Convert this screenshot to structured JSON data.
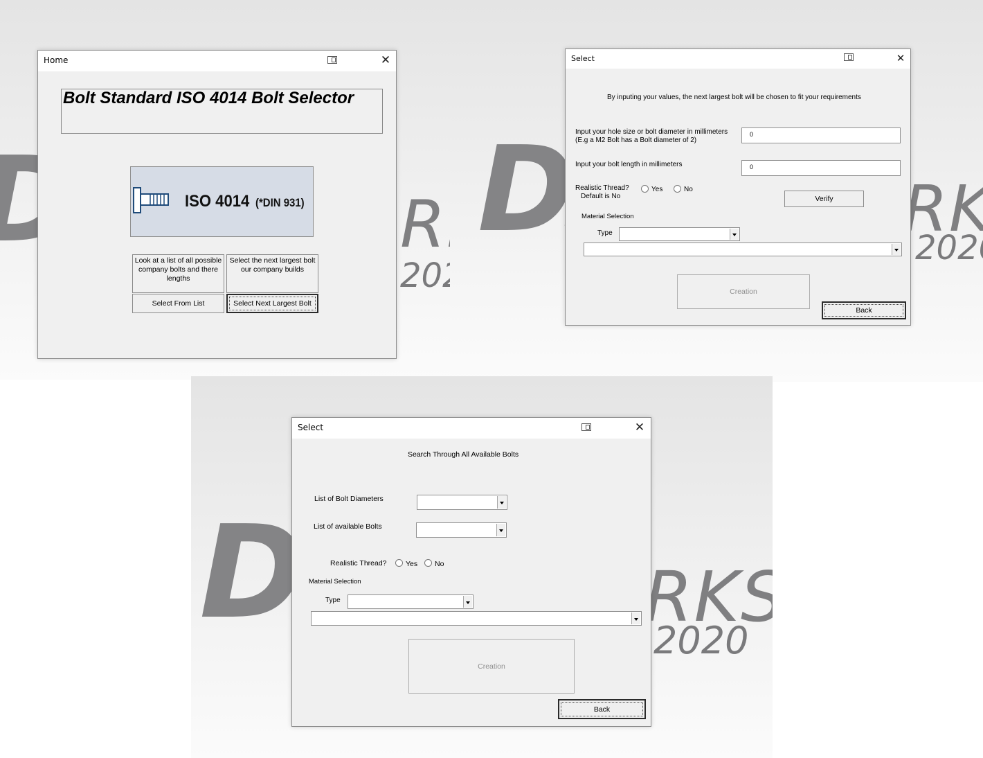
{
  "brand": {
    "logo": "DS",
    "word_1": "RK",
    "word_2": "RKS",
    "word_3": "RKS",
    "year_1": "202",
    "year_2": "2020",
    "year_3": "2020"
  },
  "home": {
    "title": "Home",
    "heading": "Bolt Standard ISO 4014 Bolt Selector",
    "image": {
      "main_text": "ISO 4014",
      "sub_text": "(*DIN 931)"
    },
    "list_desc": "Look at a list of all possible company bolts and there lengths",
    "next_desc": "Select the next largest bolt our company builds",
    "select_list_label": "Select From List",
    "select_next_label": "Select Next Largest Bolt"
  },
  "select_next": {
    "title": "Select",
    "intro": "By inputing your values, the next largest bolt will be chosen to fit your requirements",
    "hole_label_1": "Input your hole size or bolt diameter in millimeters",
    "hole_label_2": "(E.g a M2 Bolt has a Bolt diameter of 2)",
    "hole_value": "0",
    "length_label": "Input your bolt length in millimeters",
    "length_value": "0",
    "thread_label": "Realistic Thread?",
    "thread_default": "Default is No",
    "yes_label": "Yes",
    "no_label": "No",
    "verify_label": "Verify",
    "material_label": "Material Selection",
    "type_label": "Type",
    "type_value": "",
    "material_value": "",
    "creation_label": "Creation",
    "back_label": "Back"
  },
  "select_list": {
    "title": "Select",
    "intro": "Search Through All Available Bolts",
    "diam_label": "List of Bolt Diameters",
    "diam_value": "",
    "bolts_label": "List of available Bolts",
    "bolts_value": "",
    "thread_label": "Realistic Thread?",
    "yes_label": "Yes",
    "no_label": "No",
    "material_label": "Material Selection",
    "type_label": "Type",
    "type_value": "",
    "material_value": "",
    "creation_label": "Creation",
    "back_label": "Back"
  }
}
